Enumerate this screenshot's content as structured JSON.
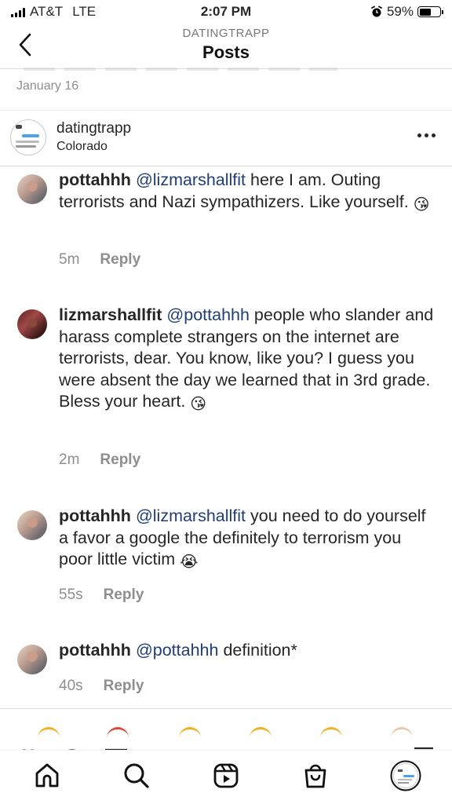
{
  "status_bar": {
    "carrier": "AT&T",
    "network": "LTE",
    "time": "2:07 PM",
    "battery_percent": "59%",
    "battery_level": 0.59
  },
  "header": {
    "subtitle": "DATINGTRAPP",
    "title": "Posts"
  },
  "post": {
    "date": "January 16",
    "username": "datingtrapp",
    "location": "Colorado"
  },
  "comments": [
    {
      "username": "pottahhh",
      "mention": "@lizmarshallfit",
      "text": " here I am. Outing terrorists and Nazi sympathizers. Like yourself. ",
      "emoji": "😘",
      "time": "5m",
      "reply_label": "Reply"
    },
    {
      "username": "lizmarshallfit",
      "mention": "@pottahhh",
      "text": " people who slander and harass complete strangers on the internet are terrorists, dear. You know, like you? I guess you were absent the day we learned that in 3rd grade. Bless your heart. ",
      "emoji": "😘",
      "time": "2m",
      "reply_label": "Reply"
    },
    {
      "username": "pottahhh",
      "mention": "@lizmarshallfit",
      "text": " you need to do yourself a favor a google the definitely to terrorism you poor little victim ",
      "emoji": "😭",
      "time": "55s",
      "reply_label": "Reply"
    },
    {
      "username": "pottahhh",
      "mention": "@pottahhh",
      "text": " definition*",
      "emoji": "",
      "time": "40s",
      "reply_label": "Reply"
    }
  ],
  "tabs": [
    {
      "icon": "home-icon"
    },
    {
      "icon": "search-icon"
    },
    {
      "icon": "reels-icon"
    },
    {
      "icon": "shop-icon"
    },
    {
      "icon": "profile-icon"
    }
  ],
  "colors": {
    "mention": "#1f3e78",
    "muted": "#8e8e8e",
    "text": "#262626"
  }
}
